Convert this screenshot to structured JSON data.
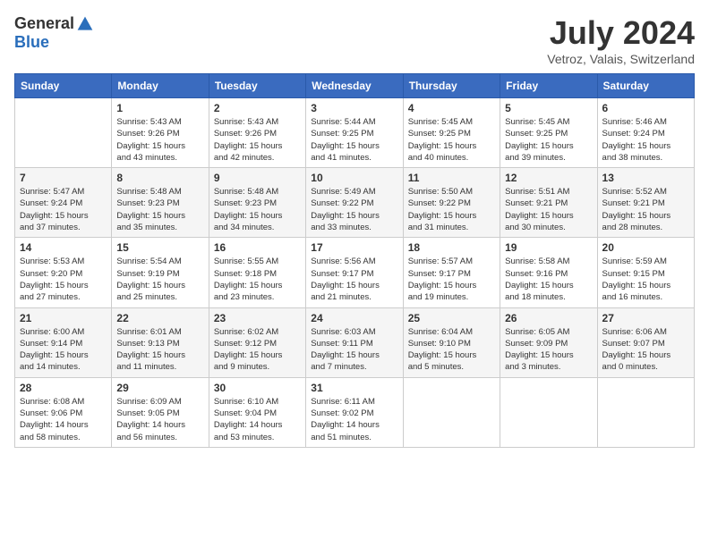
{
  "header": {
    "logo_general": "General",
    "logo_blue": "Blue",
    "month_title": "July 2024",
    "location": "Vetroz, Valais, Switzerland"
  },
  "calendar": {
    "columns": [
      "Sunday",
      "Monday",
      "Tuesday",
      "Wednesday",
      "Thursday",
      "Friday",
      "Saturday"
    ],
    "weeks": [
      [
        {
          "day": "",
          "info": ""
        },
        {
          "day": "1",
          "info": "Sunrise: 5:43 AM\nSunset: 9:26 PM\nDaylight: 15 hours\nand 43 minutes."
        },
        {
          "day": "2",
          "info": "Sunrise: 5:43 AM\nSunset: 9:26 PM\nDaylight: 15 hours\nand 42 minutes."
        },
        {
          "day": "3",
          "info": "Sunrise: 5:44 AM\nSunset: 9:25 PM\nDaylight: 15 hours\nand 41 minutes."
        },
        {
          "day": "4",
          "info": "Sunrise: 5:45 AM\nSunset: 9:25 PM\nDaylight: 15 hours\nand 40 minutes."
        },
        {
          "day": "5",
          "info": "Sunrise: 5:45 AM\nSunset: 9:25 PM\nDaylight: 15 hours\nand 39 minutes."
        },
        {
          "day": "6",
          "info": "Sunrise: 5:46 AM\nSunset: 9:24 PM\nDaylight: 15 hours\nand 38 minutes."
        }
      ],
      [
        {
          "day": "7",
          "info": "Sunrise: 5:47 AM\nSunset: 9:24 PM\nDaylight: 15 hours\nand 37 minutes."
        },
        {
          "day": "8",
          "info": "Sunrise: 5:48 AM\nSunset: 9:23 PM\nDaylight: 15 hours\nand 35 minutes."
        },
        {
          "day": "9",
          "info": "Sunrise: 5:48 AM\nSunset: 9:23 PM\nDaylight: 15 hours\nand 34 minutes."
        },
        {
          "day": "10",
          "info": "Sunrise: 5:49 AM\nSunset: 9:22 PM\nDaylight: 15 hours\nand 33 minutes."
        },
        {
          "day": "11",
          "info": "Sunrise: 5:50 AM\nSunset: 9:22 PM\nDaylight: 15 hours\nand 31 minutes."
        },
        {
          "day": "12",
          "info": "Sunrise: 5:51 AM\nSunset: 9:21 PM\nDaylight: 15 hours\nand 30 minutes."
        },
        {
          "day": "13",
          "info": "Sunrise: 5:52 AM\nSunset: 9:21 PM\nDaylight: 15 hours\nand 28 minutes."
        }
      ],
      [
        {
          "day": "14",
          "info": "Sunrise: 5:53 AM\nSunset: 9:20 PM\nDaylight: 15 hours\nand 27 minutes."
        },
        {
          "day": "15",
          "info": "Sunrise: 5:54 AM\nSunset: 9:19 PM\nDaylight: 15 hours\nand 25 minutes."
        },
        {
          "day": "16",
          "info": "Sunrise: 5:55 AM\nSunset: 9:18 PM\nDaylight: 15 hours\nand 23 minutes."
        },
        {
          "day": "17",
          "info": "Sunrise: 5:56 AM\nSunset: 9:17 PM\nDaylight: 15 hours\nand 21 minutes."
        },
        {
          "day": "18",
          "info": "Sunrise: 5:57 AM\nSunset: 9:17 PM\nDaylight: 15 hours\nand 19 minutes."
        },
        {
          "day": "19",
          "info": "Sunrise: 5:58 AM\nSunset: 9:16 PM\nDaylight: 15 hours\nand 18 minutes."
        },
        {
          "day": "20",
          "info": "Sunrise: 5:59 AM\nSunset: 9:15 PM\nDaylight: 15 hours\nand 16 minutes."
        }
      ],
      [
        {
          "day": "21",
          "info": "Sunrise: 6:00 AM\nSunset: 9:14 PM\nDaylight: 15 hours\nand 14 minutes."
        },
        {
          "day": "22",
          "info": "Sunrise: 6:01 AM\nSunset: 9:13 PM\nDaylight: 15 hours\nand 11 minutes."
        },
        {
          "day": "23",
          "info": "Sunrise: 6:02 AM\nSunset: 9:12 PM\nDaylight: 15 hours\nand 9 minutes."
        },
        {
          "day": "24",
          "info": "Sunrise: 6:03 AM\nSunset: 9:11 PM\nDaylight: 15 hours\nand 7 minutes."
        },
        {
          "day": "25",
          "info": "Sunrise: 6:04 AM\nSunset: 9:10 PM\nDaylight: 15 hours\nand 5 minutes."
        },
        {
          "day": "26",
          "info": "Sunrise: 6:05 AM\nSunset: 9:09 PM\nDaylight: 15 hours\nand 3 minutes."
        },
        {
          "day": "27",
          "info": "Sunrise: 6:06 AM\nSunset: 9:07 PM\nDaylight: 15 hours\nand 0 minutes."
        }
      ],
      [
        {
          "day": "28",
          "info": "Sunrise: 6:08 AM\nSunset: 9:06 PM\nDaylight: 14 hours\nand 58 minutes."
        },
        {
          "day": "29",
          "info": "Sunrise: 6:09 AM\nSunset: 9:05 PM\nDaylight: 14 hours\nand 56 minutes."
        },
        {
          "day": "30",
          "info": "Sunrise: 6:10 AM\nSunset: 9:04 PM\nDaylight: 14 hours\nand 53 minutes."
        },
        {
          "day": "31",
          "info": "Sunrise: 6:11 AM\nSunset: 9:02 PM\nDaylight: 14 hours\nand 51 minutes."
        },
        {
          "day": "",
          "info": ""
        },
        {
          "day": "",
          "info": ""
        },
        {
          "day": "",
          "info": ""
        }
      ]
    ]
  }
}
